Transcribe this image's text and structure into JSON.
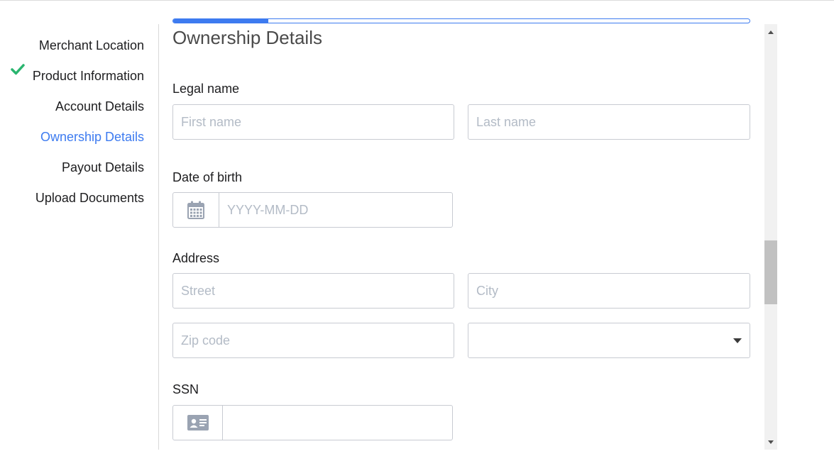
{
  "steps": {
    "merchant_location": "Merchant Location",
    "product_information": "Product Information",
    "account_details": "Account Details",
    "ownership_details": "Ownership Details",
    "payout_details": "Payout Details",
    "upload_documents": "Upload Documents"
  },
  "completed_step": "Merchant Location",
  "active_step": "Ownership Details",
  "progress": {
    "fraction": 0.165
  },
  "form": {
    "heading": "Ownership Details",
    "legal_name": {
      "label": "Legal name",
      "first_placeholder": "First name",
      "last_placeholder": "Last name"
    },
    "dob": {
      "label": "Date of birth",
      "placeholder": "YYYY-MM-DD",
      "icon": "calendar-icon"
    },
    "address": {
      "label": "Address",
      "street_placeholder": "Street",
      "city_placeholder": "City",
      "zip_placeholder": "Zip code",
      "state_value": ""
    },
    "ssn": {
      "label": "SSN",
      "icon": "id-card-icon",
      "value": ""
    }
  },
  "colors": {
    "accent": "#3d7bf0",
    "check": "#2ab56f",
    "placeholder": "#b3bbc6"
  }
}
